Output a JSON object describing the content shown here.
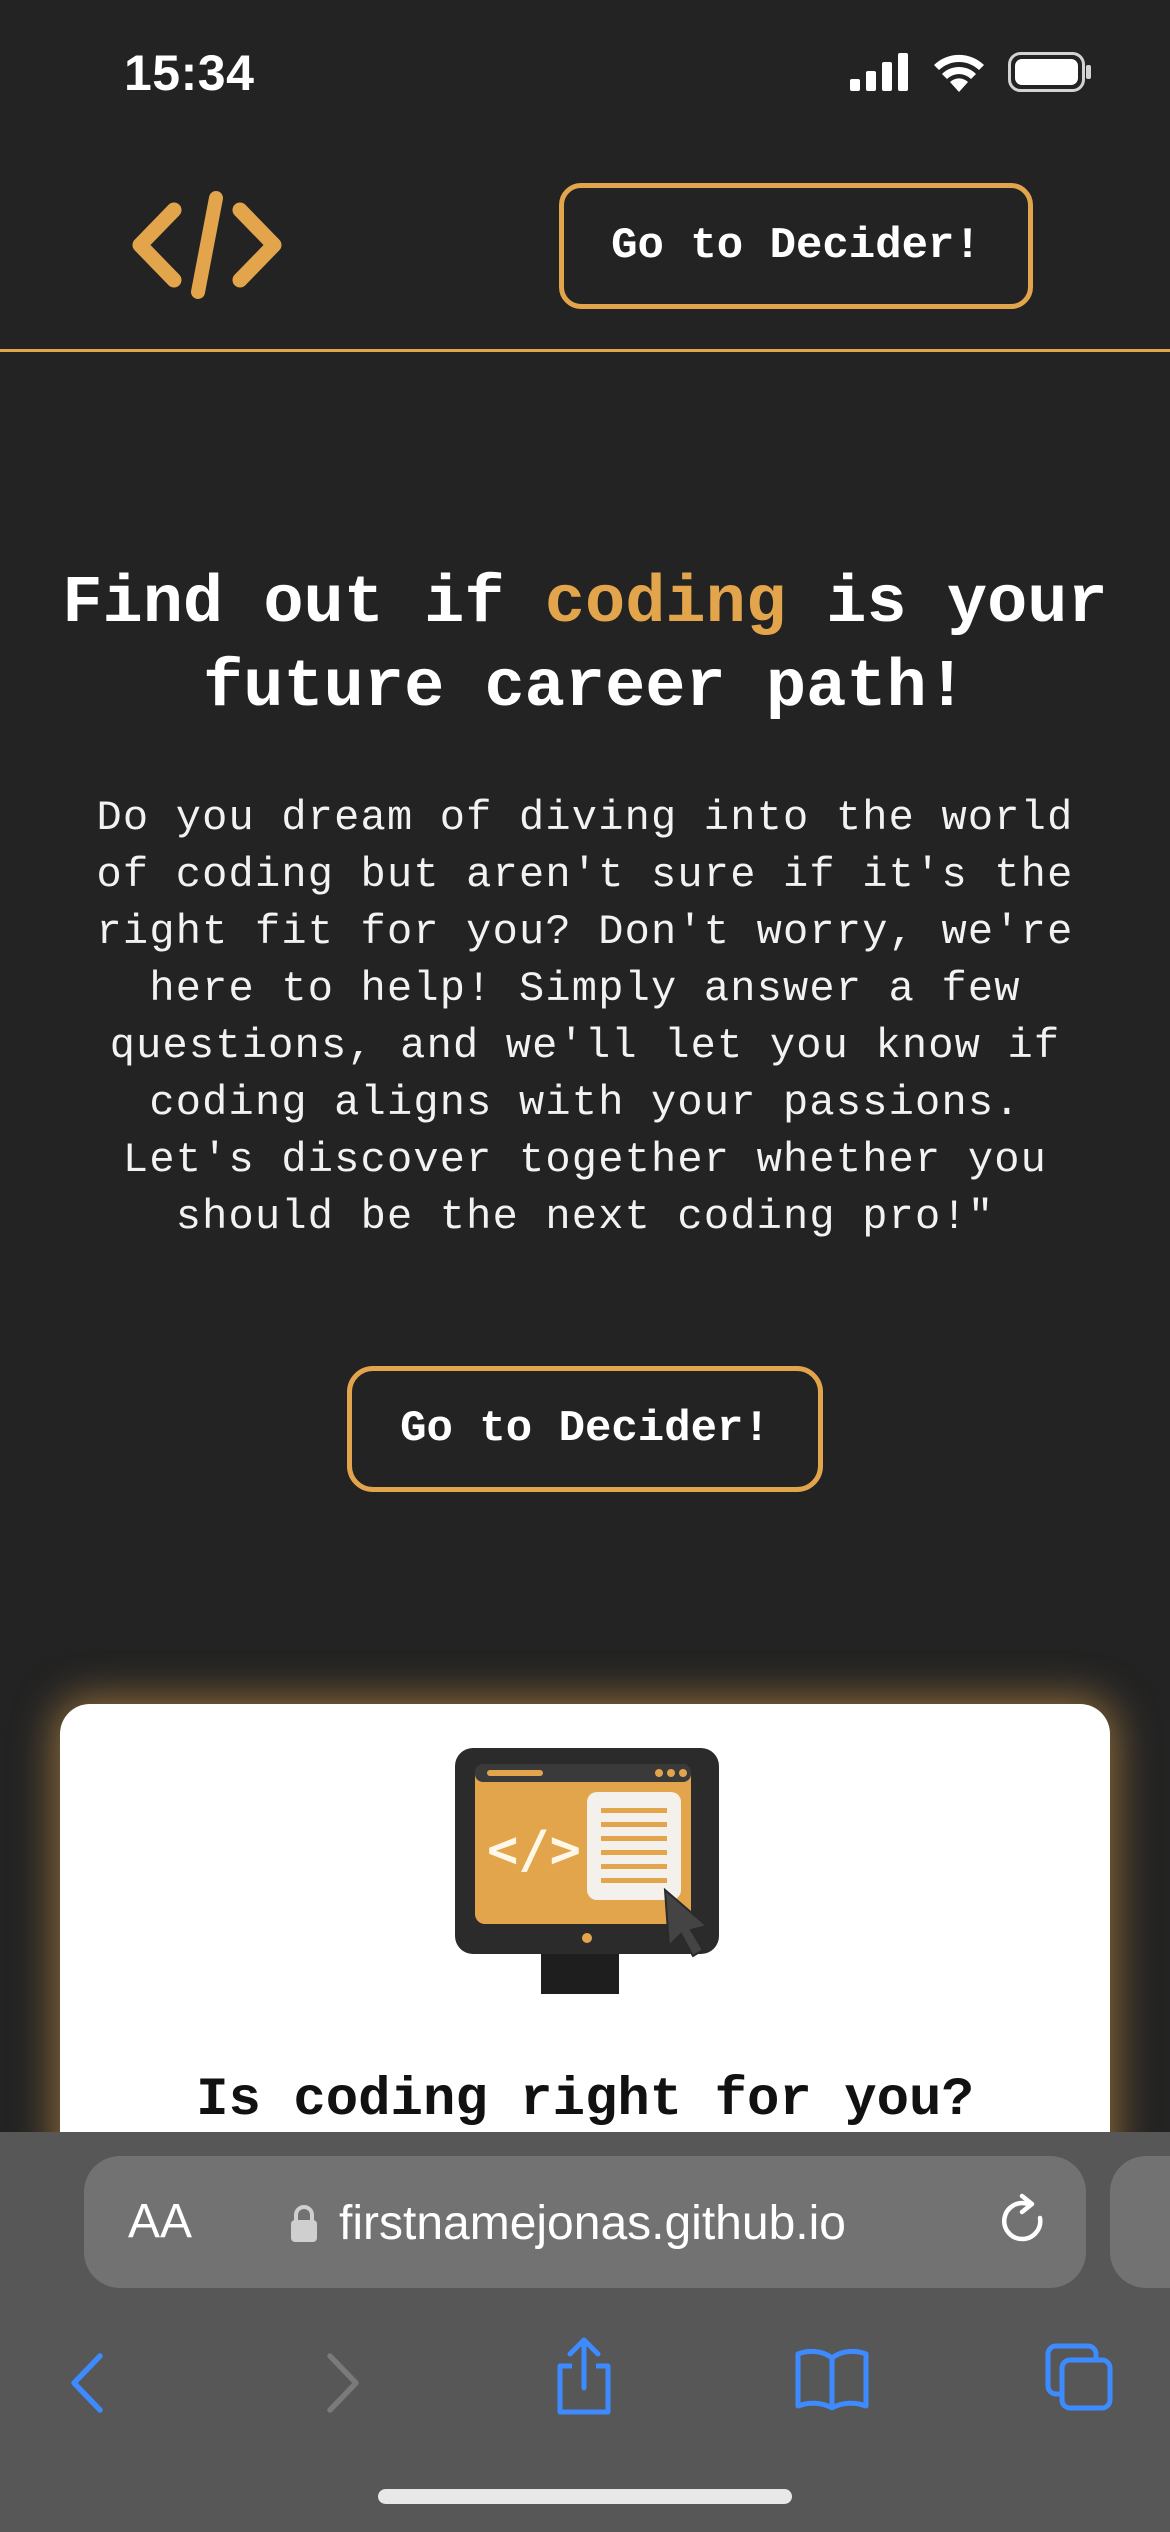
{
  "status_bar": {
    "time": "15:34",
    "icons": [
      "cellular-signal-icon",
      "wifi-icon",
      "battery-icon"
    ]
  },
  "header": {
    "logo_icon": "code-brackets-icon",
    "button_label": "Go to Decider!"
  },
  "hero": {
    "title_part1": "Find out if ",
    "title_accent": "coding",
    "title_part2": " is your future career path!",
    "text": "Do you dream of diving into the world of coding but aren't sure if it's the right fit for you? Don't worry, we're here to help! Simply answer a few questions, and we'll let you know if coding aligns with your passions. Let's discover together whether you should be the next coding pro!\"",
    "button_label": "Go to Decider!"
  },
  "card": {
    "illustration_icon": "computer-code-icon",
    "title": "Is coding right for you?"
  },
  "browser": {
    "text_size_label": "AA",
    "url": "firstnamejonas.github.io",
    "toolbar_icons": [
      "back-icon",
      "forward-icon",
      "share-icon",
      "bookmarks-icon",
      "tabs-icon"
    ]
  },
  "colors": {
    "background": "#232323",
    "accent": "#e3a54c",
    "card": "#ffffff",
    "browser_chrome": "#575757",
    "ios_blue": "#3d8bff"
  }
}
